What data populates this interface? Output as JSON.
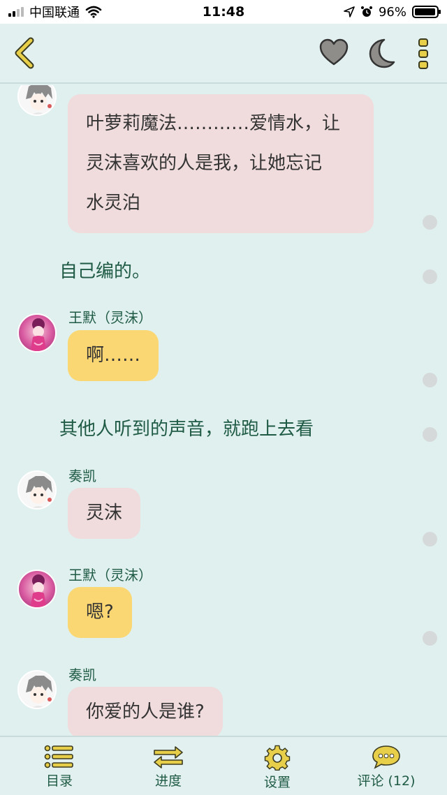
{
  "status_bar": {
    "carrier": "中国联通",
    "time": "11:48",
    "battery": "96%",
    "battery_level": 0.96
  },
  "nav": {
    "icons": [
      "back-icon",
      "heart-icon",
      "moon-icon",
      "more-icon"
    ]
  },
  "messages": [
    {
      "type": "bubble",
      "speaker": "奏凯",
      "text": "叶萝莉魔法…………爱情水，让灵沫喜欢的人是我，让她忘记水灵泊"
    },
    {
      "type": "narration",
      "text": "自己编的。"
    },
    {
      "type": "bubble",
      "speaker": "王默（灵沫）",
      "text": "啊……"
    },
    {
      "type": "narration",
      "text": "其他人听到的声音，就跑上去看"
    },
    {
      "type": "bubble",
      "speaker": "奏凯",
      "text": "灵沫"
    },
    {
      "type": "bubble",
      "speaker": "王默（灵沫）",
      "text": "嗯?"
    },
    {
      "type": "bubble",
      "speaker": "奏凯",
      "text": "你爱的人是谁?"
    }
  ],
  "chat": {
    "m1_line1": "叶萝莉魔法…………爱情水，让",
    "m1_line2": "灵沫喜欢的人是我，让她忘记",
    "m1_line3": "水灵泊",
    "narr1": "自己编的。",
    "name_ling": "王默（灵沫）",
    "m2": "啊……",
    "narr2": "其他人听到的声音，就跑上去看",
    "name_kai": "奏凯",
    "m3": "灵沫",
    "m4": "嗯?",
    "m5": "你爱的人是谁?"
  },
  "tabs": [
    {
      "label": "目录",
      "icon": "list-icon"
    },
    {
      "label": "进度",
      "icon": "swap-arrows-icon"
    },
    {
      "label": "设置",
      "icon": "gear-icon"
    },
    {
      "label": "评论 (12)",
      "icon": "chat-bubble-icon"
    }
  ],
  "colors": {
    "background": "#dff0ef",
    "pink_bubble": "#f0dcdd",
    "yellow_bubble": "#fad773",
    "accent_text": "#1f5a44",
    "icon_yellow": "#e8cf4a"
  }
}
